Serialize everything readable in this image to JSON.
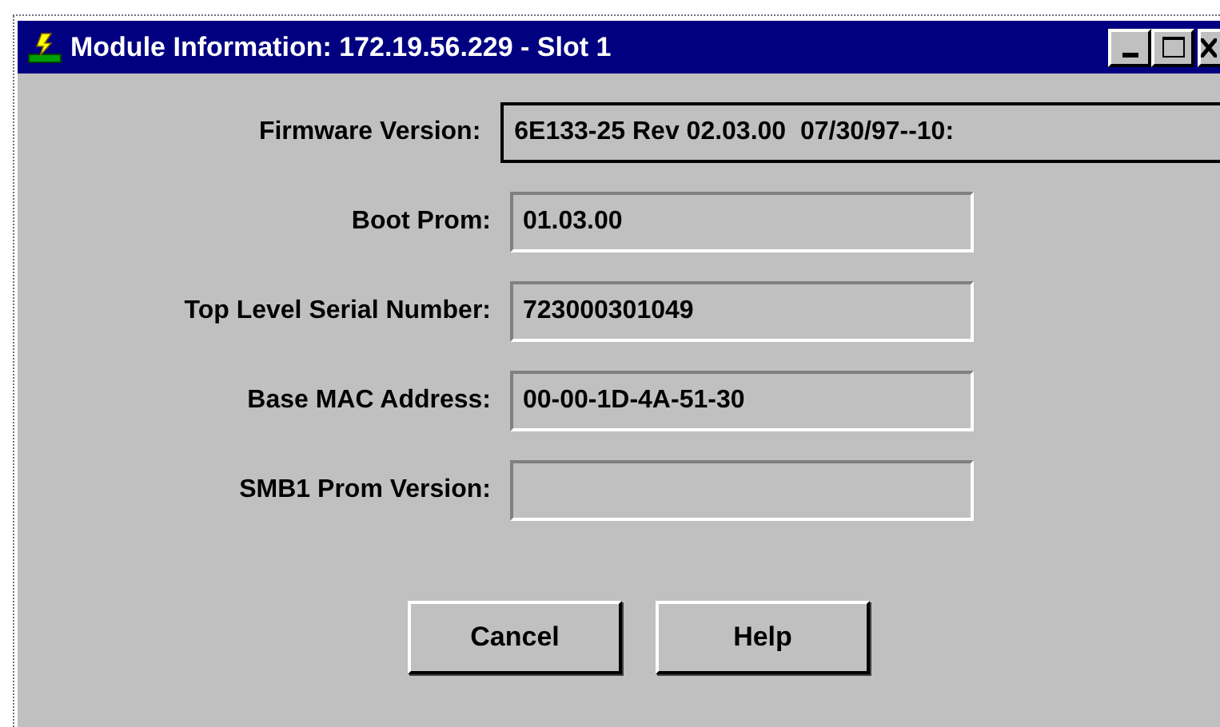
{
  "window": {
    "title": "Module Information: 172.19.56.229 - Slot 1"
  },
  "fields": [
    {
      "label": "Firmware Version:",
      "value": "6E133-25 Rev 02.03.00  07/30/97--10:",
      "focused": true
    },
    {
      "label": "Boot Prom:",
      "value": "01.03.00",
      "focused": false
    },
    {
      "label": "Top Level Serial Number:",
      "value": "723000301049",
      "focused": false
    },
    {
      "label": "Base MAC Address:",
      "value": "00-00-1D-4A-51-30",
      "focused": false
    },
    {
      "label": "SMB1 Prom Version:",
      "focused": false
    }
  ],
  "buttons": [
    "Cancel",
    "Help"
  ]
}
